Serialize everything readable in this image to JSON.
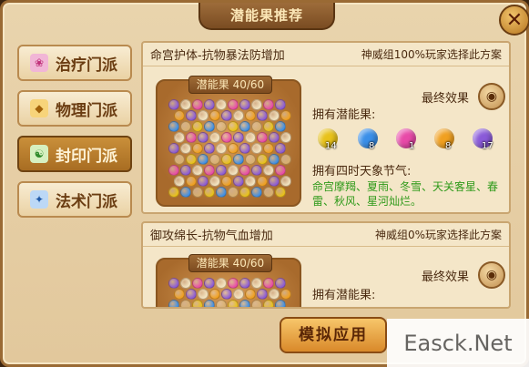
{
  "window": {
    "title": "潜能果推荐",
    "close_label": "✕"
  },
  "sidebar": {
    "items": [
      {
        "label": "治疗门派",
        "icon": "healing-icon",
        "icon_color": "#e05aa0",
        "active": false
      },
      {
        "label": "物理门派",
        "icon": "physical-icon",
        "icon_color": "#e6a21a",
        "active": false
      },
      {
        "label": "封印门派",
        "icon": "seal-icon",
        "icon_color": "#46b04a",
        "active": true
      },
      {
        "label": "法术门派",
        "icon": "magic-icon",
        "icon_color": "#3a7fd6",
        "active": false
      }
    ]
  },
  "plans": [
    {
      "name": "命宫护体-抗物暴法防增加",
      "popularity": "神威组100%玩家选择此方案",
      "board_label": "潜能果 40/60",
      "final_effect_label": "最终效果",
      "owned_label": "拥有潜能果:",
      "fruits": [
        {
          "color": "#e8c21a",
          "count": "14"
        },
        {
          "color": "#3a8fe8",
          "count": "8"
        },
        {
          "color": "#e84aa8",
          "count": "1"
        },
        {
          "color": "#f0a020",
          "count": "8"
        },
        {
          "color": "#8a5ad8",
          "count": "17"
        }
      ],
      "terms_label": "拥有四时天象节气:",
      "terms": "命宫摩羯、夏雨、冬雪、天关客星、春雷、秋风、星河灿烂。"
    },
    {
      "name": "御攻绵长-抗物气血增加",
      "popularity": "神威组0%玩家选择此方案",
      "board_label": "潜能果 40/60",
      "final_effect_label": "最终效果",
      "owned_label": "拥有潜能果:"
    }
  ],
  "simulate_button": "模拟应用",
  "watermark": "Easck.Net"
}
